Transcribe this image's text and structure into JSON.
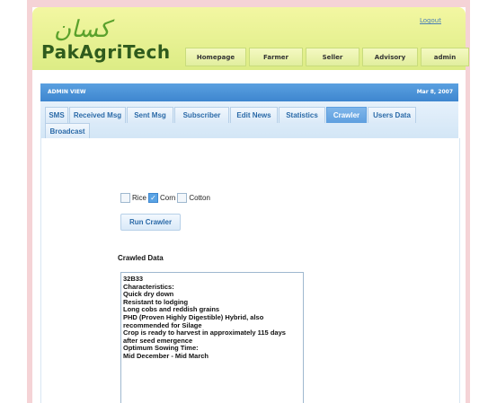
{
  "header": {
    "urdu_title": "کسان",
    "logo_text": "PakAgriTech",
    "logout_label": "Logout",
    "nav": [
      "Homepage",
      "Farmer",
      "Seller",
      "Advisory",
      "admin"
    ]
  },
  "band": {
    "label": "ADMIN VIEW",
    "date": "Mar 8, 2007"
  },
  "tabs": {
    "row1": [
      "SMS",
      "Received Msg",
      "Sent Msg",
      "Subscriber",
      "Edit News",
      "Statistics",
      "Crawler",
      "Users Data"
    ],
    "row2": [
      "Broadcast"
    ],
    "active": "Crawler"
  },
  "crawler": {
    "options": [
      {
        "label": "Rice",
        "checked": false
      },
      {
        "label": "Corn",
        "checked": true
      },
      {
        "label": "Cotton",
        "checked": false
      }
    ],
    "run_button": "Run Crawler",
    "data_label": "Crawled Data",
    "data_lines": [
      "32B33",
      "Characteristics:",
      "Quick dry down",
      "Resistant to lodging",
      "Long cobs and reddish grains",
      "PHD (Proven Highly Digestible) Hybrid, also",
      "recommended for Silage",
      "Crop is ready to harvest in approximately 115 days",
      "after seed emergence",
      "Optimum Sowing Time:",
      "Mid December - Mid March"
    ]
  },
  "colors": {
    "frame": "#f5d3d6",
    "header_green": "#dcec85",
    "band_blue": "#3e86cf",
    "active_tab": "#5e9fdf"
  }
}
